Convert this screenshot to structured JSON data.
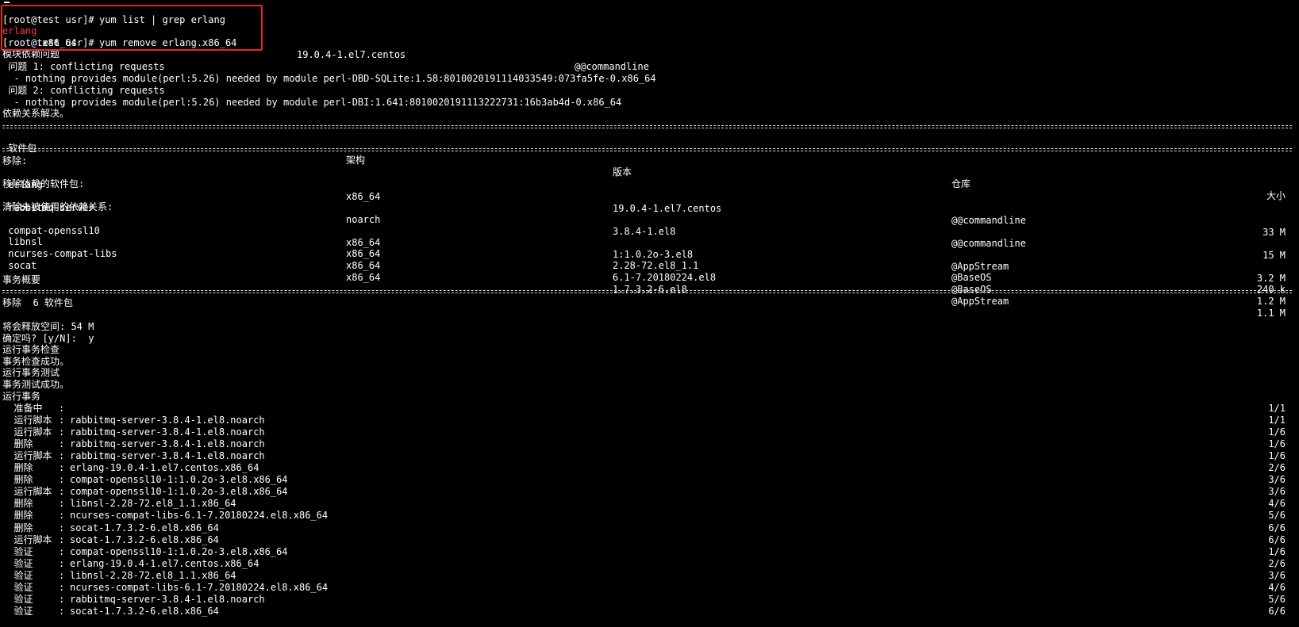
{
  "cmd1": {
    "prompt": "[root@test usr]# ",
    "command": "yum list | grep erlang"
  },
  "list_row": {
    "name_hl": "erlang",
    "name_rest": ".x86_64",
    "version": "19.0.4-1.el7.centos",
    "repo": "@@commandline"
  },
  "cmd2": {
    "prompt": "[root@test usr]# ",
    "command": "yum remove erlang.x86_64"
  },
  "dep_issue": "模块依赖问题",
  "problems": [
    {
      "title": " 问题 1: conflicting requests",
      "detail": "  - nothing provides module(perl:5.26) needed by module perl-DBD-SQLite:1.58:8010020191114033549:073fa5fe-0.x86_64"
    },
    {
      "title": " 问题 2: conflicting requests",
      "detail": "  - nothing provides module(perl:5.26) needed by module perl-DBI:1.641:8010020191113222731:16b3ab4d-0.x86_64"
    }
  ],
  "resolved": "依赖关系解决。",
  "headers": {
    "package": " 软件包",
    "arch": "架构",
    "version": "版本",
    "repo": "仓库",
    "size": "大小"
  },
  "groups": [
    {
      "label": "移除:",
      "rows": [
        {
          "name": " erlang",
          "arch": "x86_64",
          "version": "19.0.4-1.el7.centos",
          "repo": "@@commandline",
          "size": "33 M"
        }
      ]
    },
    {
      "label": "移除依赖的软件包:",
      "rows": [
        {
          "name": " rabbitmq-server",
          "arch": "noarch",
          "version": "3.8.4-1.el8",
          "repo": "@@commandline",
          "size": "15 M"
        }
      ]
    },
    {
      "label": "清除未被使用的依赖关系:",
      "rows": [
        {
          "name": " compat-openssl10",
          "arch": "x86_64",
          "version": "1:1.0.2o-3.el8",
          "repo": "@AppStream",
          "size": "3.2 M"
        },
        {
          "name": " libnsl",
          "arch": "x86_64",
          "version": "2.28-72.el8_1.1",
          "repo": "@BaseOS",
          "size": "240 k"
        },
        {
          "name": " ncurses-compat-libs",
          "arch": "x86_64",
          "version": "6.1-7.20180224.el8",
          "repo": "@BaseOS",
          "size": "1.2 M"
        },
        {
          "name": " socat",
          "arch": "x86_64",
          "version": "1.7.3.2-6.el8",
          "repo": "@AppStream",
          "size": "1.1 M"
        }
      ]
    }
  ],
  "summary_title": "事务概要",
  "summary_line": "移除  6 软件包",
  "free_space": "将会释放空间: 54 M",
  "confirm": "确定吗? [y/N]:  y",
  "status_lines": [
    "运行事务检查",
    "事务检查成功。",
    "运行事务测试",
    "事务测试成功。",
    "运行事务"
  ],
  "steps": [
    {
      "action": "  准备中  ",
      "pkg": "",
      "count": "1/1"
    },
    {
      "action": "  运行脚本",
      "pkg": "rabbitmq-server-3.8.4-1.el8.noarch",
      "count": "1/1"
    },
    {
      "action": "  运行脚本",
      "pkg": "rabbitmq-server-3.8.4-1.el8.noarch",
      "count": "1/6"
    },
    {
      "action": "  删除    ",
      "pkg": "rabbitmq-server-3.8.4-1.el8.noarch",
      "count": "1/6"
    },
    {
      "action": "  运行脚本",
      "pkg": "rabbitmq-server-3.8.4-1.el8.noarch",
      "count": "1/6"
    },
    {
      "action": "  删除    ",
      "pkg": "erlang-19.0.4-1.el7.centos.x86_64",
      "count": "2/6"
    },
    {
      "action": "  删除    ",
      "pkg": "compat-openssl10-1:1.0.2o-3.el8.x86_64",
      "count": "3/6"
    },
    {
      "action": "  运行脚本",
      "pkg": "compat-openssl10-1:1.0.2o-3.el8.x86_64",
      "count": "3/6"
    },
    {
      "action": "  删除    ",
      "pkg": "libnsl-2.28-72.el8_1.1.x86_64",
      "count": "4/6"
    },
    {
      "action": "  删除    ",
      "pkg": "ncurses-compat-libs-6.1-7.20180224.el8.x86_64",
      "count": "5/6"
    },
    {
      "action": "  删除    ",
      "pkg": "socat-1.7.3.2-6.el8.x86_64",
      "count": "6/6"
    },
    {
      "action": "  运行脚本",
      "pkg": "socat-1.7.3.2-6.el8.x86_64",
      "count": "6/6"
    },
    {
      "action": "  验证    ",
      "pkg": "compat-openssl10-1:1.0.2o-3.el8.x86_64",
      "count": "1/6"
    },
    {
      "action": "  验证    ",
      "pkg": "erlang-19.0.4-1.el7.centos.x86_64",
      "count": "2/6"
    },
    {
      "action": "  验证    ",
      "pkg": "libnsl-2.28-72.el8_1.1.x86_64",
      "count": "3/6"
    },
    {
      "action": "  验证    ",
      "pkg": "ncurses-compat-libs-6.1-7.20180224.el8.x86_64",
      "count": "4/6"
    },
    {
      "action": "  验证    ",
      "pkg": "rabbitmq-server-3.8.4-1.el8.noarch",
      "count": "5/6"
    },
    {
      "action": "  验证    ",
      "pkg": "socat-1.7.3.2-6.el8.x86_64",
      "count": "6/6"
    }
  ],
  "colors": {
    "background": "#000000",
    "text": "#ffffff",
    "highlight": "#ff3b3b",
    "box": "#e3262a"
  }
}
